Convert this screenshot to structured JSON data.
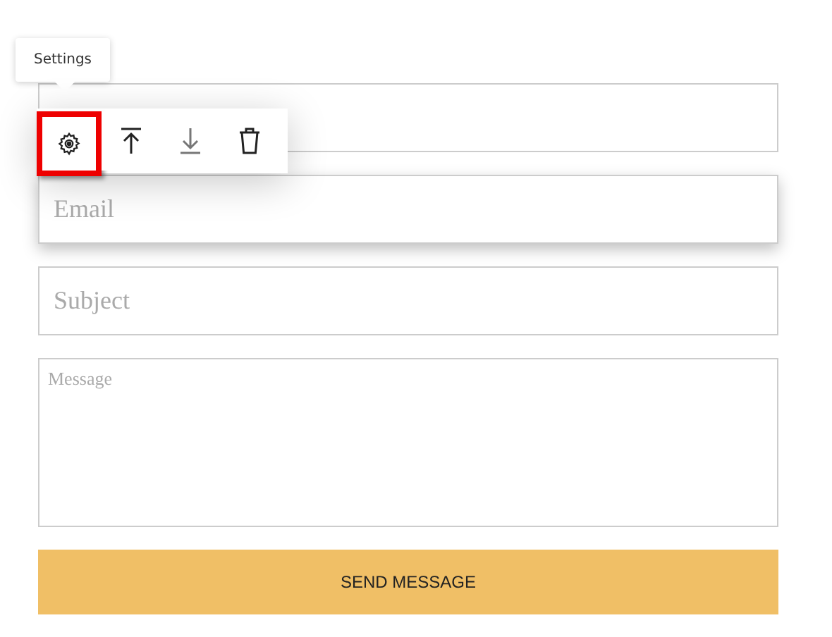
{
  "tooltip": {
    "text": "Settings"
  },
  "toolbar": {
    "tools": [
      {
        "kind": "settings",
        "selected": true
      },
      {
        "kind": "move-up",
        "selected": false
      },
      {
        "kind": "move-down",
        "selected": false
      },
      {
        "kind": "delete",
        "selected": false
      }
    ]
  },
  "form": {
    "fields": [
      {
        "kind": "input",
        "focused": false
      },
      {
        "kind": "input",
        "placeholder": "Email",
        "focused": true
      },
      {
        "kind": "input",
        "placeholder": "Subject",
        "focused": false
      },
      {
        "kind": "textarea",
        "placeholder": "Message",
        "focused": false
      }
    ],
    "submit": "SEND MESSAGE"
  }
}
